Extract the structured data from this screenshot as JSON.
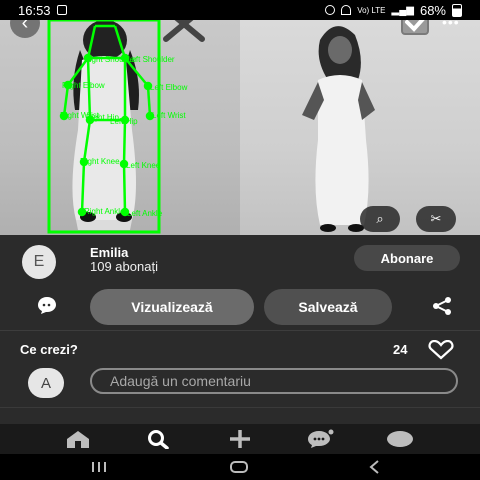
{
  "status_bar": {
    "time": "16:53",
    "battery": "68%",
    "network": "Vo) LTE"
  },
  "pin": {
    "author_initial": "E",
    "author_name": "Emilia",
    "followers": "109 abonați",
    "follow_label": "Abonare",
    "visit_label": "Vizualizează",
    "save_label": "Salvează",
    "comments_title": "Ce crezi?",
    "like_count": "24",
    "user_initial": "A",
    "comment_placeholder": "Adaugă un comentariu"
  },
  "pose_labels": [
    "Right Shoulder",
    "Left Shoulder",
    "Right Elbow",
    "Left Elbow",
    "Right Wrist",
    "Left Wrist",
    "Right Hip",
    "Left Hip",
    "Right Knee",
    "Left Knee",
    "Right Ankle",
    "Left Ankle"
  ],
  "colors": {
    "pose_overlay": "#00ff00",
    "background": "#2b2b2b",
    "status_bar": "#000000"
  },
  "icons": {
    "back": "chevron-left-icon",
    "reject": "x-icon",
    "accept": "checkbox-icon",
    "more": "more-dots-icon",
    "lens": "visual-search-icon",
    "crop": "scissors-icon",
    "comment": "comment-bubble-icon",
    "share": "share-icon",
    "heart": "heart-icon",
    "nav": [
      "home-icon",
      "search-icon",
      "create-plus-icon",
      "messages-icon",
      "profile-icon"
    ],
    "system_nav": [
      "recents-icon",
      "home-pill-icon",
      "back-icon"
    ]
  }
}
